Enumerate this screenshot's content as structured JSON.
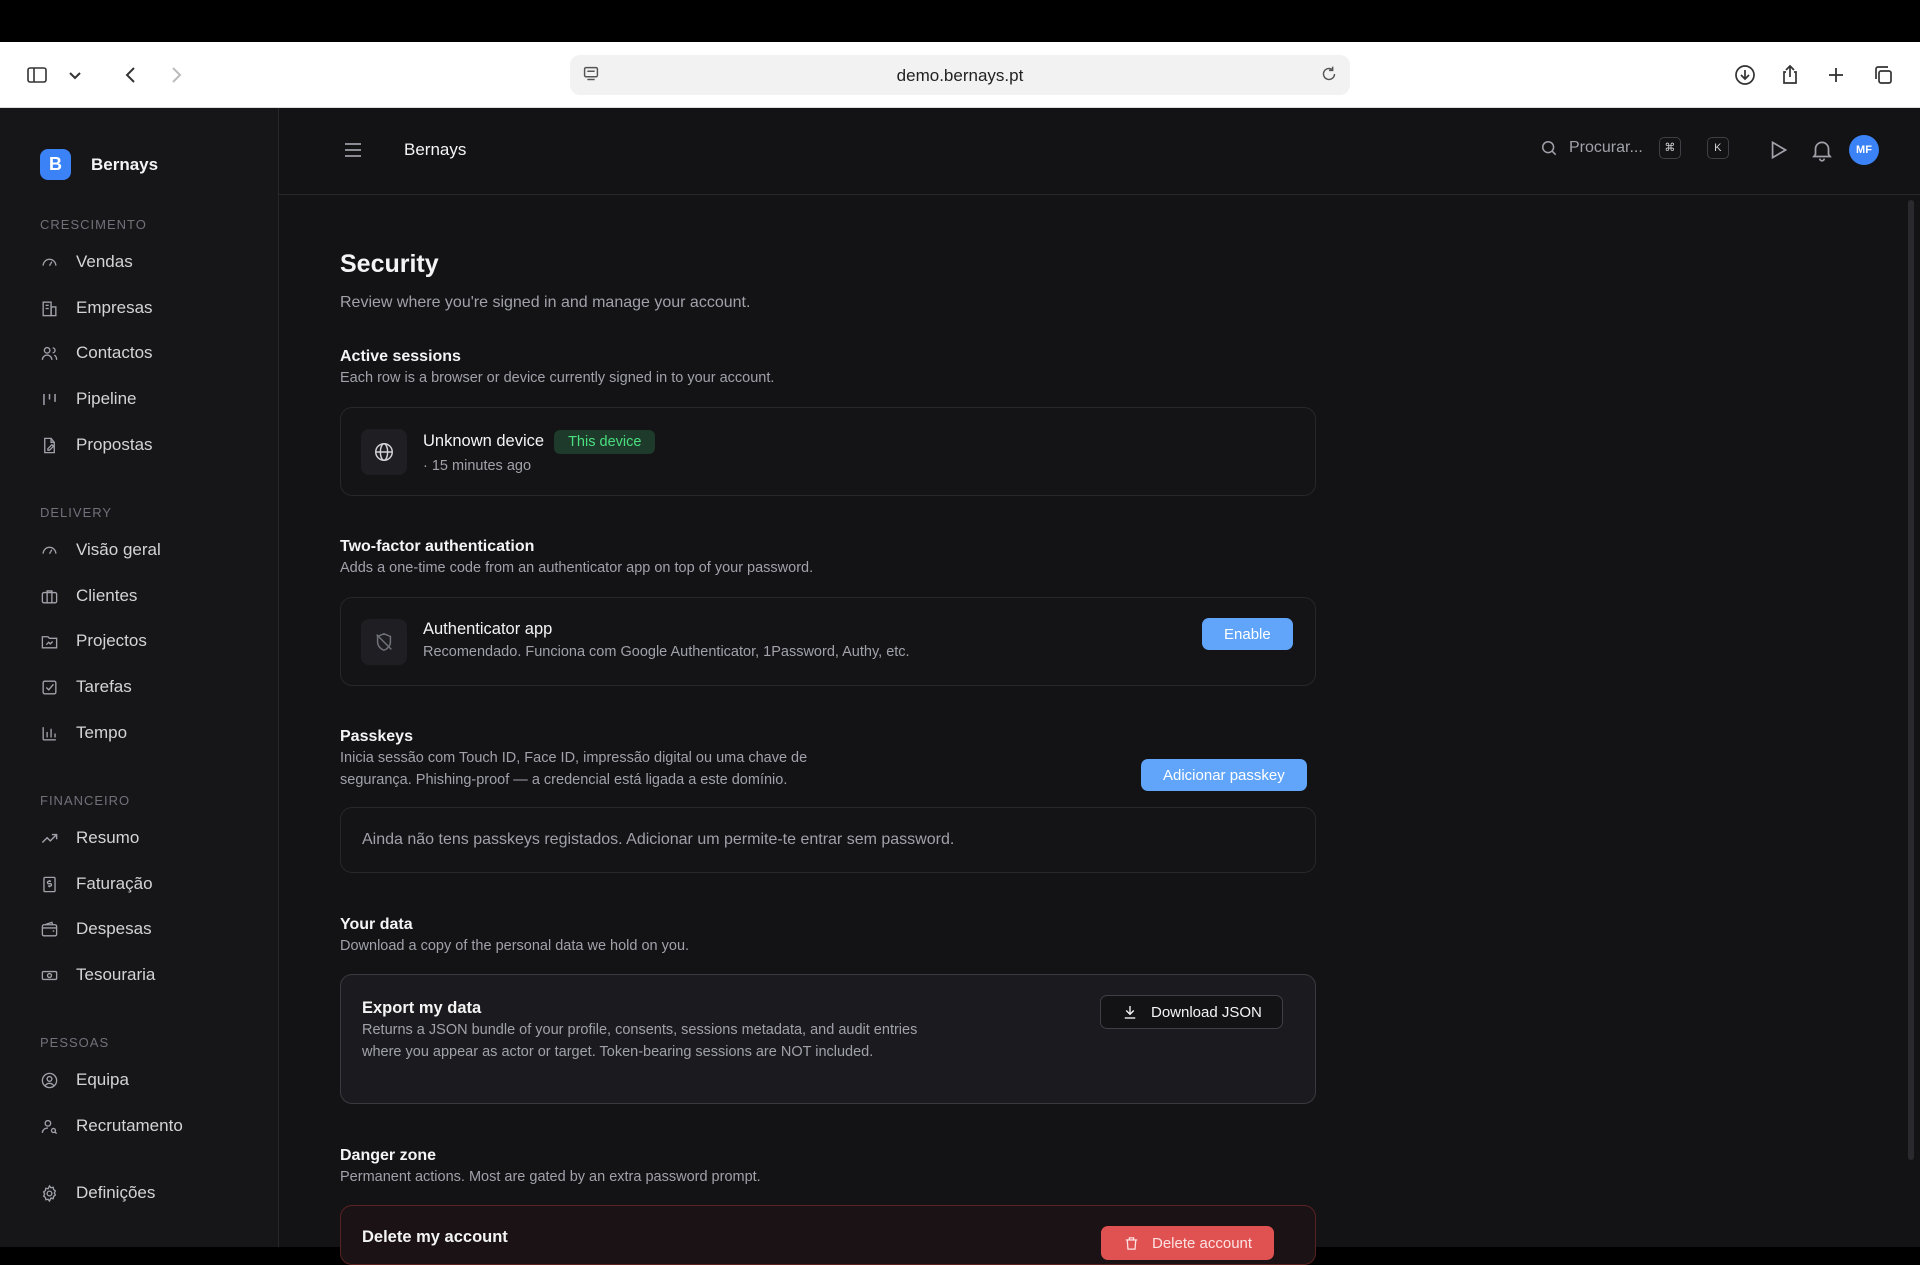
{
  "browser": {
    "url": "demo.bernays.pt"
  },
  "sidebar": {
    "brand": {
      "letter": "B",
      "name": "Bernays"
    },
    "sections": [
      {
        "label": "CRESCIMENTO",
        "items": [
          "Vendas",
          "Empresas",
          "Contactos",
          "Pipeline",
          "Propostas"
        ]
      },
      {
        "label": "DELIVERY",
        "items": [
          "Visão geral",
          "Clientes",
          "Projectos",
          "Tarefas",
          "Tempo"
        ]
      },
      {
        "label": "FINANCEIRO",
        "items": [
          "Resumo",
          "Faturação",
          "Despesas",
          "Tesouraria"
        ]
      },
      {
        "label": "PESSOAS",
        "items": [
          "Equipa",
          "Recrutamento"
        ]
      }
    ],
    "settings": "Definições"
  },
  "header": {
    "title": "Bernays",
    "search_placeholder": "Procurar...",
    "kbd_cmd": "⌘",
    "kbd_k": "K",
    "avatar": "MF"
  },
  "page": {
    "title": "Security",
    "subtitle": "Review where you're signed in and manage your account.",
    "sessions": {
      "title": "Active sessions",
      "desc": "Each row is a browser or device currently signed in to your account.",
      "device": "Unknown device",
      "badge": "This device",
      "meta": "· 15 minutes ago"
    },
    "twofa": {
      "title": "Two-factor authentication",
      "desc": "Adds a one-time code from an authenticator app on top of your password.",
      "app_title": "Authenticator app",
      "app_desc": "Recomendado. Funciona com Google Authenticator, 1Password, Authy, etc.",
      "enable": "Enable"
    },
    "passkeys": {
      "title": "Passkeys",
      "desc": "Inicia sessão com Touch ID, Face ID, impressão digital ou uma chave de segurança. Phishing-proof — a credencial está ligada a este domínio.",
      "add": "Adicionar passkey",
      "empty": "Ainda não tens passkeys registados. Adicionar um permite-te entrar sem password."
    },
    "data": {
      "title": "Your data",
      "desc": "Download a copy of the personal data we hold on you.",
      "export_title": "Export my data",
      "export_desc": "Returns a JSON bundle of your profile, consents, sessions metadata, and audit entries where you appear as actor or target. Token-bearing sessions are NOT included.",
      "download": "Download JSON"
    },
    "danger": {
      "title": "Danger zone",
      "desc": "Permanent actions. Most are gated by an extra password prompt.",
      "delete_title": "Delete my account",
      "delete_btn": "Delete account"
    }
  }
}
